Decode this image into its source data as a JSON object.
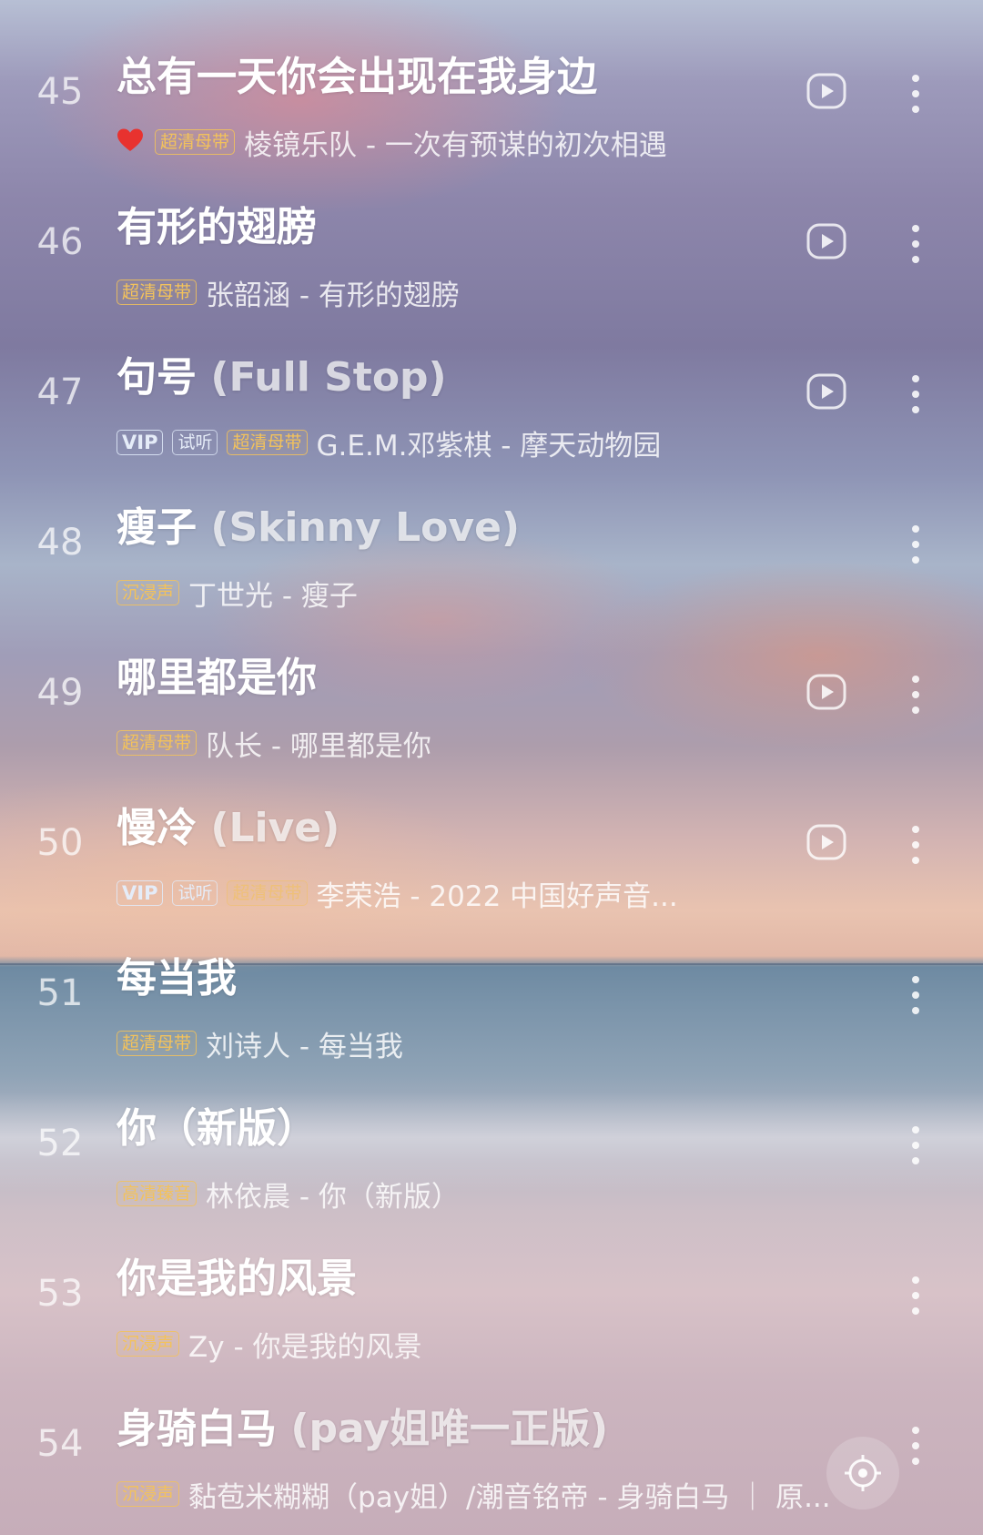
{
  "songs": [
    {
      "index": "45",
      "title": "总有一天你会出现在我身边",
      "title_sub": "",
      "liked": true,
      "tags": [
        {
          "text": "超清母带",
          "kind": "gold"
        }
      ],
      "artist_album": "棱镜乐队 - 一次有预谋的初次相遇",
      "has_play": true
    },
    {
      "index": "46",
      "title": "有形的翅膀",
      "title_sub": "",
      "liked": false,
      "tags": [
        {
          "text": "超清母带",
          "kind": "gold"
        }
      ],
      "artist_album": "张韶涵 - 有形的翅膀",
      "has_play": true
    },
    {
      "index": "47",
      "title": "句号",
      "title_sub": "(Full Stop)",
      "liked": false,
      "tags": [
        {
          "text": "VIP",
          "kind": "vip"
        },
        {
          "text": "试听",
          "kind": "try"
        },
        {
          "text": "超清母带",
          "kind": "gold"
        }
      ],
      "artist_album": "G.E.M.邓紫棋 - 摩天动物园",
      "has_play": true
    },
    {
      "index": "48",
      "title": "瘦子",
      "title_sub": "(Skinny Love)",
      "liked": false,
      "tags": [
        {
          "text": "沉浸声",
          "kind": "gold"
        }
      ],
      "artist_album": "丁世光 - 瘦子",
      "has_play": false
    },
    {
      "index": "49",
      "title": "哪里都是你",
      "title_sub": "",
      "liked": false,
      "tags": [
        {
          "text": "超清母带",
          "kind": "gold"
        }
      ],
      "artist_album": "队长 - 哪里都是你",
      "has_play": true
    },
    {
      "index": "50",
      "title": "慢冷",
      "title_sub": "(Live)",
      "liked": false,
      "tags": [
        {
          "text": "VIP",
          "kind": "vip"
        },
        {
          "text": "试听",
          "kind": "try"
        },
        {
          "text": "超清母带",
          "kind": "gold-faded"
        }
      ],
      "artist_album": "李荣浩 - 2022 中国好声音...",
      "has_play": true
    },
    {
      "index": "51",
      "title": "每当我",
      "title_sub": "",
      "liked": false,
      "tags": [
        {
          "text": "超清母带",
          "kind": "gold"
        }
      ],
      "artist_album": "刘诗人 - 每当我",
      "has_play": false
    },
    {
      "index": "52",
      "title": "你（新版）",
      "title_sub": "",
      "liked": false,
      "tags": [
        {
          "text": "高清臻音",
          "kind": "gold"
        }
      ],
      "artist_album": "林依晨 - 你（新版）",
      "has_play": false
    },
    {
      "index": "53",
      "title": "你是我的风景",
      "title_sub": "",
      "liked": false,
      "tags": [
        {
          "text": "沉浸声",
          "kind": "gold"
        }
      ],
      "artist_album": "Zy - 你是我的风景",
      "has_play": false
    },
    {
      "index": "54",
      "title": "身骑白马",
      "title_sub": "(pay姐唯一正版)",
      "liked": false,
      "tags": [
        {
          "text": "沉浸声",
          "kind": "gold"
        }
      ],
      "artist_album": "黏苞米糊糊（pay姐）/潮音铭帝 - 身骑白马 ｜ 原...",
      "has_play": false
    }
  ],
  "icons": {
    "play": "play-circle-icon",
    "more": "more-vertical-icon",
    "liked": "heart-icon",
    "locate": "locate-current-icon"
  },
  "colors": {
    "heart": "#e8322f",
    "tag_gold": "#f3c25b",
    "tag_vip": "#e5ecf8"
  }
}
